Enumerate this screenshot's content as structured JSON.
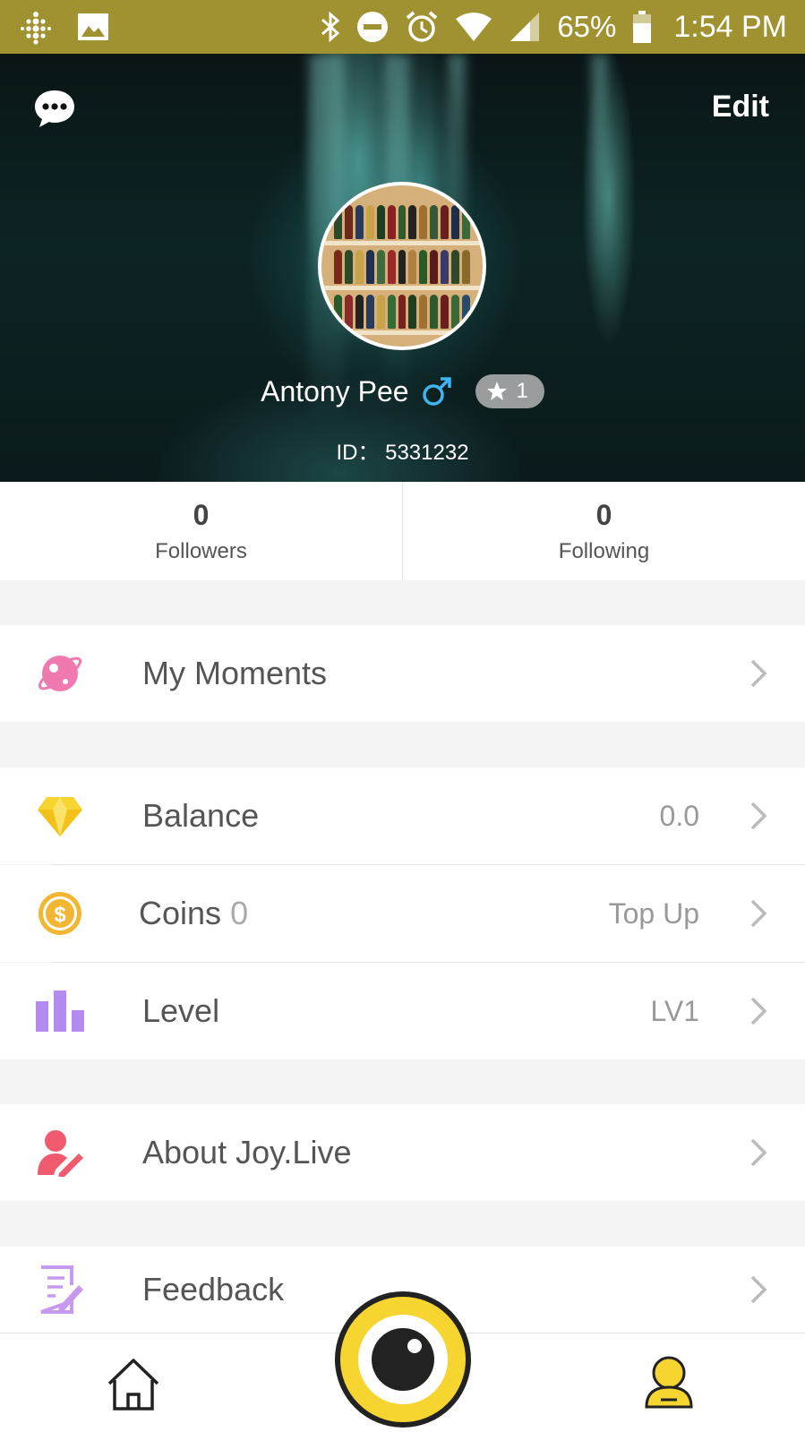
{
  "status_bar": {
    "battery": "65%",
    "time": "1:54 PM",
    "icons": [
      "fitbit-icon",
      "image-icon",
      "bluetooth-icon",
      "do-not-disturb-icon",
      "alarm-icon",
      "wifi-icon",
      "signal-icon",
      "battery-icon"
    ]
  },
  "profile": {
    "edit_label": "Edit",
    "name": "Antony Pee",
    "level_badge": "1",
    "id_text": "ID： 5331232"
  },
  "stats": {
    "followers_count": "0",
    "followers_label": "Followers",
    "following_count": "0",
    "following_label": "Following"
  },
  "menu": {
    "moments": {
      "label": "My Moments"
    },
    "balance": {
      "label": "Balance",
      "value": "0.0"
    },
    "coins": {
      "label": "Coins",
      "count": "0",
      "value": "Top Up"
    },
    "level": {
      "label": "Level",
      "value": "LV1"
    },
    "about": {
      "label": "About Joy.Live"
    },
    "feedback": {
      "label": "Feedback"
    }
  },
  "colors": {
    "status_bar": "#a09230",
    "accent_yellow": "#f7d530",
    "male_blue": "#3fb5f2",
    "moments_pink": "#f07ab0",
    "coins_gold": "#f2b632",
    "level_purple": "#b48cf0",
    "about_red": "#f05a6e"
  }
}
